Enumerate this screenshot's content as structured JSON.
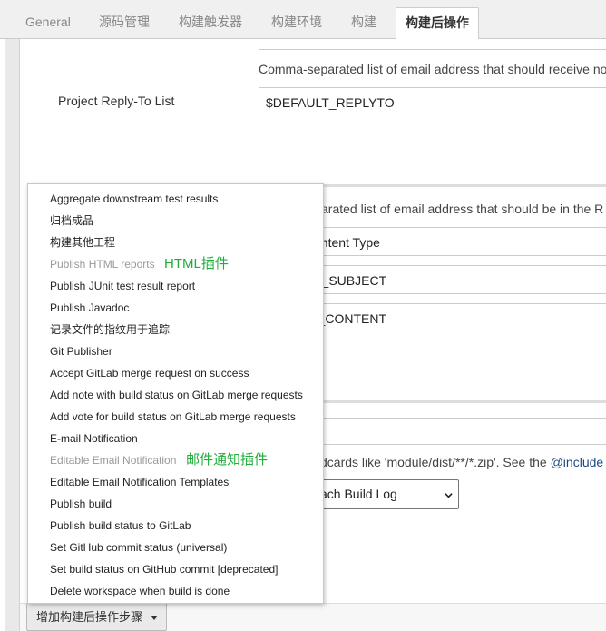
{
  "tabs": [
    {
      "label": "General"
    },
    {
      "label": "源码管理"
    },
    {
      "label": "构建触发器"
    },
    {
      "label": "构建环境"
    },
    {
      "label": "构建"
    },
    {
      "label": "构建后操作"
    }
  ],
  "hints": {
    "recipients": "Comma-separated list of email address that should receive no",
    "reply_partial": "arated list of email address that should be in the R",
    "attachments_partial": "dcards like 'module/dist/**/*.zip'. See the ",
    "attachments_link": "@include"
  },
  "form": {
    "reply_to_label": "Project Reply-To List",
    "reply_to_value": "$DEFAULT_REPLYTO",
    "content_type_partial": "ontent Type",
    "subject_partial": "T_SUBJECT",
    "content_partial": "T_CONTENT",
    "attach_log_selected": "ach Build Log"
  },
  "menu": {
    "items": [
      {
        "label": "Aggregate downstream test results",
        "enabled": true
      },
      {
        "label": "归档成品",
        "enabled": true
      },
      {
        "label": "构建其他工程",
        "enabled": true
      },
      {
        "label": "Publish HTML reports",
        "enabled": false
      },
      {
        "label": "Publish JUnit test result report",
        "enabled": true
      },
      {
        "label": "Publish Javadoc",
        "enabled": true
      },
      {
        "label": "记录文件的指纹用于追踪",
        "enabled": true
      },
      {
        "label": "Git Publisher",
        "enabled": true
      },
      {
        "label": "Accept GitLab merge request on success",
        "enabled": true
      },
      {
        "label": "Add note with build status on GitLab merge requests",
        "enabled": true
      },
      {
        "label": "Add vote for build status on GitLab merge requests",
        "enabled": true
      },
      {
        "label": "E-mail Notification",
        "enabled": true
      },
      {
        "label": "Editable Email Notification",
        "enabled": false
      },
      {
        "label": "Editable Email Notification Templates",
        "enabled": true
      },
      {
        "label": "Publish build",
        "enabled": true
      },
      {
        "label": "Publish build status to GitLab",
        "enabled": true
      },
      {
        "label": "Set GitHub commit status (universal)",
        "enabled": true
      },
      {
        "label": "Set build status on GitHub commit [deprecated]",
        "enabled": true
      },
      {
        "label": "Delete workspace when build is done",
        "enabled": true
      }
    ],
    "annotations": {
      "html_plugin": "HTML插件",
      "email_plugin": "邮件通知插件"
    }
  },
  "footer": {
    "add_step_label": "增加构建后操作步骤"
  },
  "colors": {
    "annotation": "#1fae3a",
    "disabled_text": "#999999",
    "link": "#204a87"
  }
}
